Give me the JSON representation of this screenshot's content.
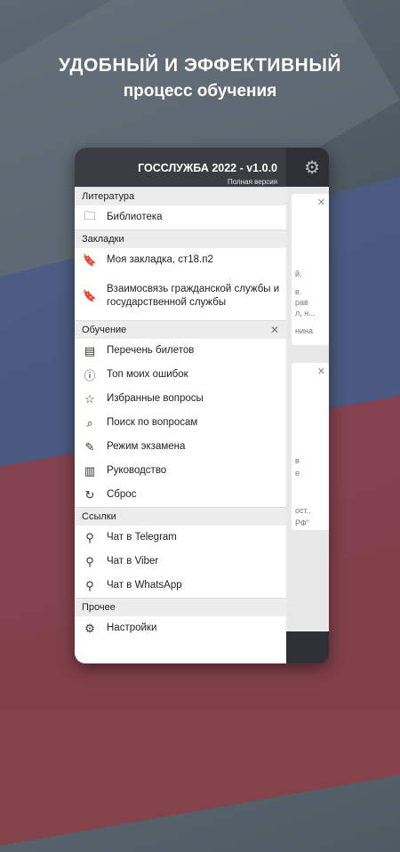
{
  "headline": {
    "line1": "УДОБНЫЙ И ЭФФЕКТИВНЫЙ",
    "line2": "процесс обучения"
  },
  "app": {
    "title": "ГОССЛУЖБА 2022 - v1.0.0",
    "subtitle": "Полная версия"
  },
  "sections": {
    "literature": {
      "label": "Литература",
      "items": [
        {
          "label": "Библиотека",
          "icon": "folder-icon"
        }
      ]
    },
    "bookmarks": {
      "label": "Закладки",
      "items": [
        {
          "label": "Моя закладка, ст18.п2",
          "icon": "bookmark-icon"
        },
        {
          "label": "Взаимосвязь гражданской службы и государственной службы",
          "icon": "bookmark-icon"
        }
      ]
    },
    "learning": {
      "label": "Обучение",
      "close_icon": "close-icon",
      "items": [
        {
          "label": "Перечень билетов",
          "icon": "list-icon"
        },
        {
          "label": "Топ моих ошибок",
          "icon": "alert-icon"
        },
        {
          "label": "Избранные вопросы",
          "icon": "star-icon"
        },
        {
          "label": "Поиск по вопросам",
          "icon": "search-icon"
        },
        {
          "label": "Режим экзамена",
          "icon": "exam-icon"
        },
        {
          "label": "Руководство",
          "icon": "document-icon"
        },
        {
          "label": "Сброс",
          "icon": "reset-icon"
        }
      ]
    },
    "links": {
      "label": "Ссылки",
      "items": [
        {
          "label": "Чат в Telegram",
          "icon": "link-icon"
        },
        {
          "label": "Чат в Viber",
          "icon": "link-icon"
        },
        {
          "label": "Чат в WhatsApp",
          "icon": "link-icon"
        }
      ]
    },
    "other": {
      "label": "Прочее",
      "items": [
        {
          "label": "Настройки",
          "icon": "gear-icon"
        }
      ]
    }
  },
  "background_cards": {
    "card1_lines": [
      "й,",
      "в.",
      "рав",
      "л, н...",
      "нина"
    ],
    "card2_lines": [
      "в",
      "е",
      "ост..",
      "РФ\""
    ]
  }
}
